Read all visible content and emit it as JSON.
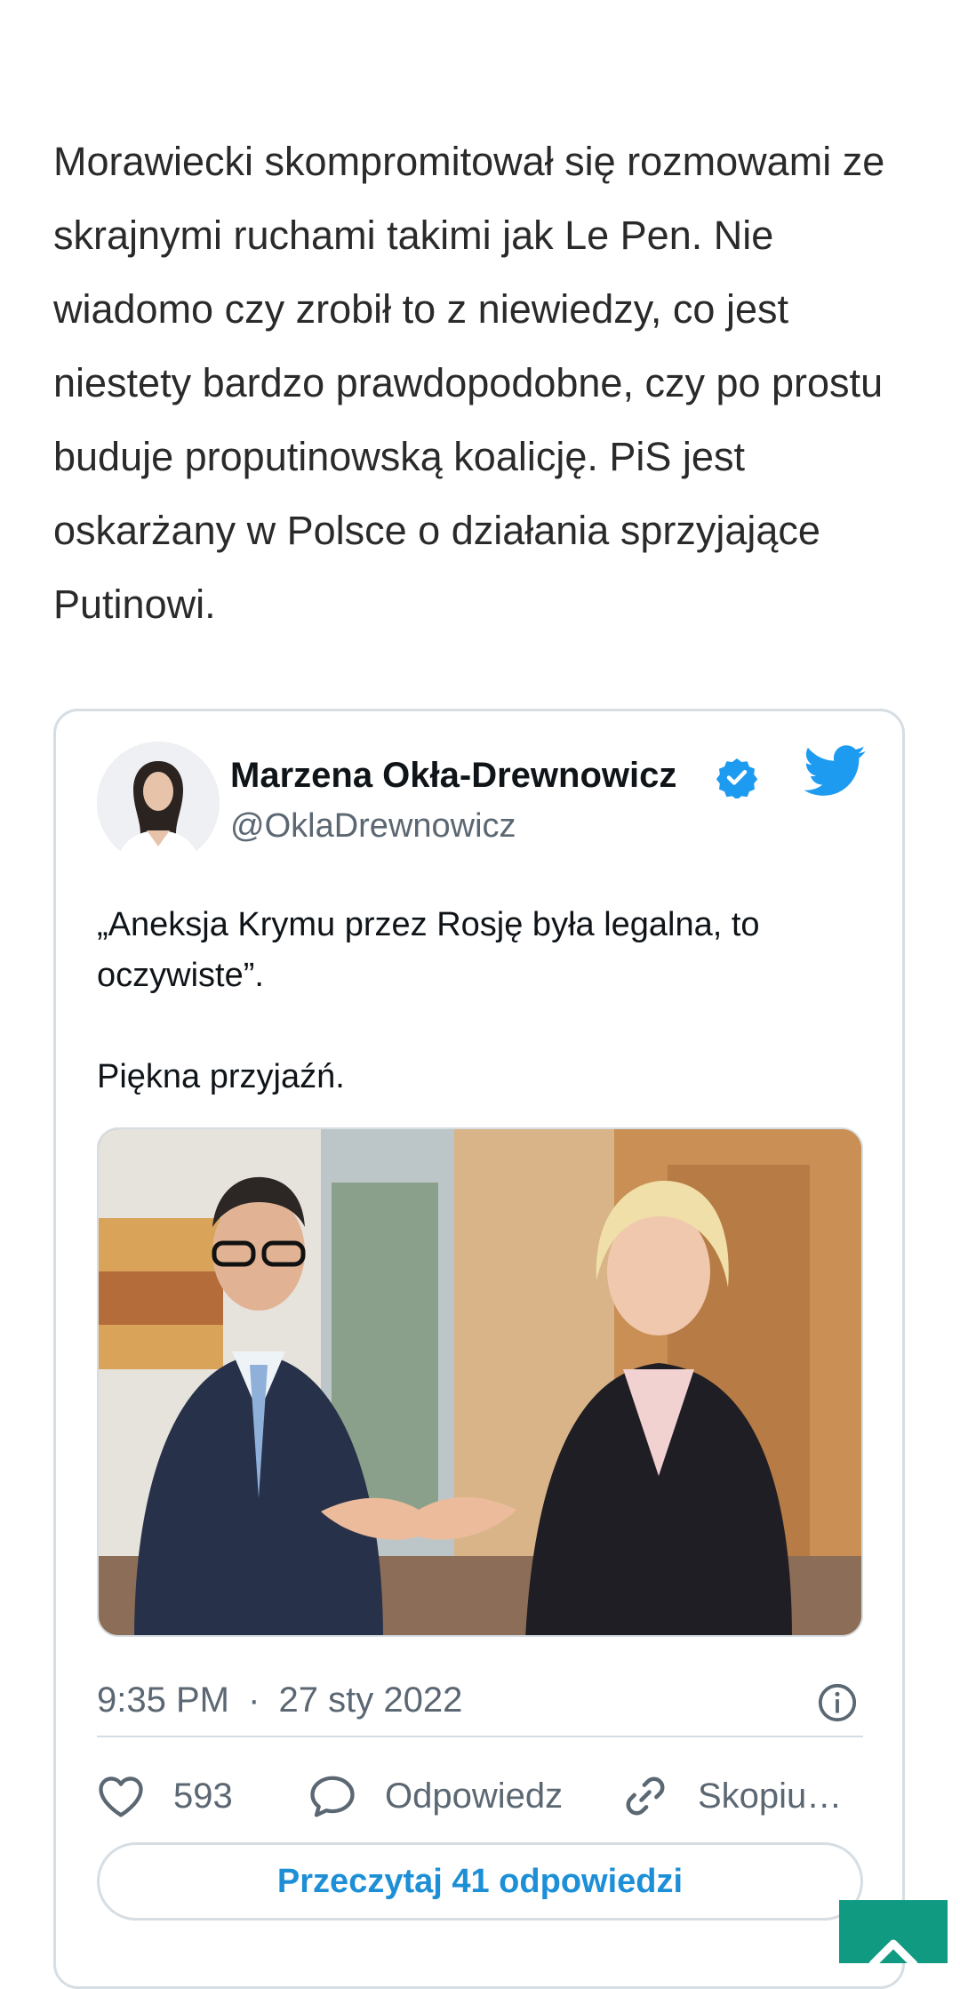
{
  "article": {
    "paragraph": "Morawiecki skompromitował się rozmowami ze skrajnymi ruchami takimi jak Le Pen. Nie wiadomo czy zrobił to z niewiedzy, co jest niestety bardzo prawdopodobne, czy po prostu buduje proputinowską koalicję. PiS jest oskarżany w Polsce o działania sprzyjające Putinowi."
  },
  "tweet": {
    "author_name": "Marzena Okła-Drewnowicz",
    "handle": "@OklaDrewnowicz",
    "text": "„Aneksja Krymu przez Rosję była legalna, to oczywiste”.\n\nPiękna przyjaźń.",
    "time": "9:35 PM",
    "separator": "·",
    "date": "27 sty 2022",
    "likes": "593",
    "reply_label": "Odpowiedz",
    "copy_label": "Skopiu…",
    "read_replies": "Przeczytaj 41 odpowiedzi"
  },
  "colors": {
    "twitter_blue": "#1d9bf0",
    "link_blue": "#1d8fd6",
    "accent_teal": "#109a82"
  },
  "icons": [
    "verified-badge-icon",
    "twitter-bird-icon",
    "info-icon",
    "heart-icon",
    "reply-bubble-icon",
    "link-icon",
    "chevron-up-icon"
  ]
}
